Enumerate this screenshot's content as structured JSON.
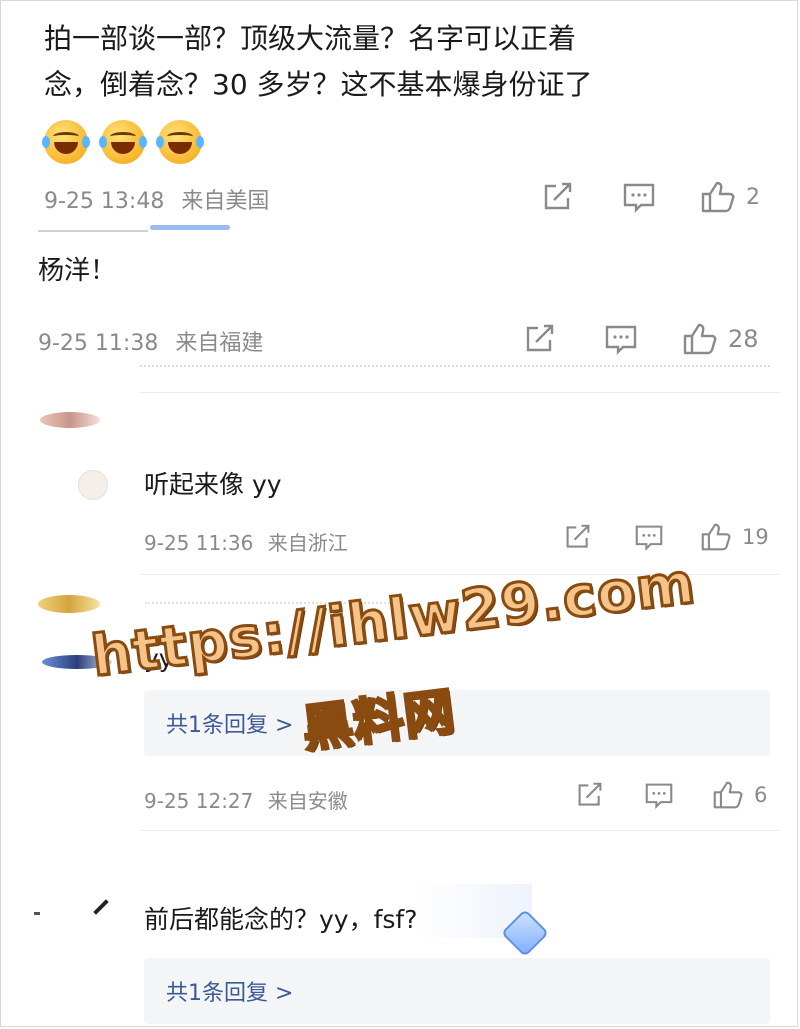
{
  "comments": [
    {
      "text": "拍一部谈一部？顶级大流量？名字可以正着念，倒着念？30多岁？这不基本爆身份证了",
      "line1": "拍一部谈一部？顶级大流量？名字可以正着",
      "line2": "念，倒着念？30 多岁？这不基本爆身份证了",
      "emoji_count": 3,
      "time": "9-25 13:48",
      "location": "来自美国",
      "likes": "2"
    },
    {
      "text": "杨洋！",
      "time": "9-25 11:38",
      "location": "来自福建",
      "likes": "28"
    }
  ],
  "replies": [
    {
      "text": "听起来像 yy",
      "time": "9-25 11:36",
      "location": "来自浙江",
      "likes": "19"
    },
    {
      "text": "yy",
      "reply_link": "共1条回复 >",
      "time": "9-25 12:27",
      "location": "来自安徽",
      "likes": "6"
    },
    {
      "text": "前后都能念的？yy，fsf?",
      "reply_link": "共1条回复 >"
    }
  ],
  "watermark": {
    "url": "https://ihlw29.com",
    "label": "黑料网"
  },
  "colors": {
    "link": "#3c5a96",
    "meta": "#8a8a8a",
    "watermark_fill": "#f5c48a",
    "watermark_stroke": "#8a4b10"
  },
  "icons": [
    "share-icon",
    "comment-icon",
    "like-icon",
    "laugh-cry-emoji"
  ]
}
